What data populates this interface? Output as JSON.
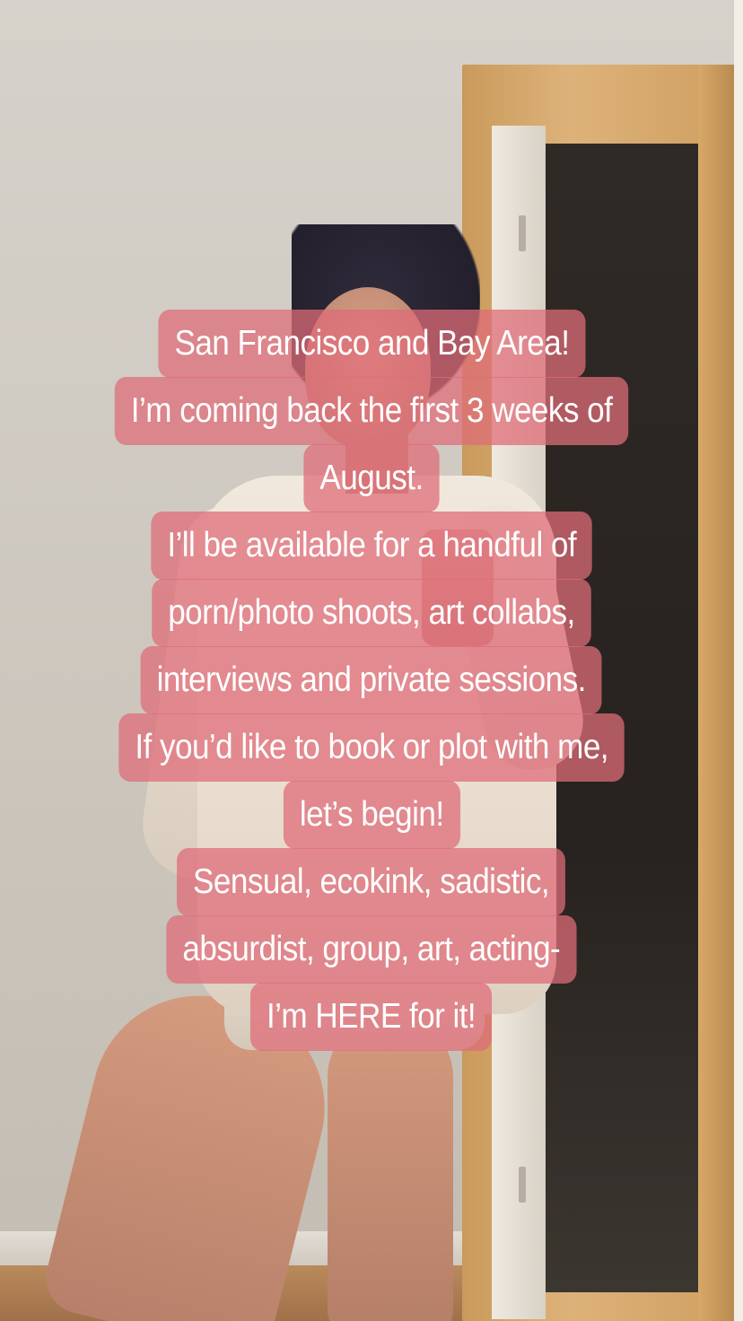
{
  "story": {
    "caption_lines": [
      "San Francisco and Bay Area!",
      "I’m coming back the first 3 weeks of",
      "August.",
      "I’ll be available for a handful of",
      "porn/photo shoots, art collabs,",
      "interviews and private sessions.",
      "If you’d like to book or plot with me,",
      "let’s begin!",
      "Sensual, ecokink, sadistic,",
      "absurdist, group, art, acting-",
      "I’m HERE for it!"
    ],
    "text_background_color": "#de6c78",
    "text_color": "#ffffff"
  }
}
